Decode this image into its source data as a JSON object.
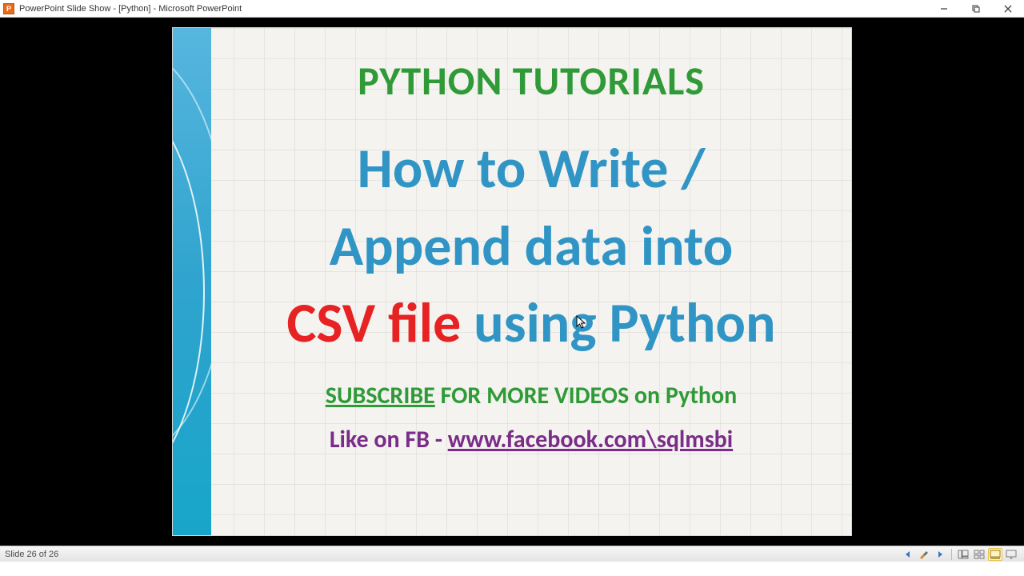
{
  "titlebar": {
    "app_icon_letter": "P",
    "title": "PowerPoint Slide Show - [Python] - Microsoft PowerPoint"
  },
  "slide": {
    "heading": "PYTHON TUTORIALS",
    "line1": "How to Write /",
    "line2": "Append data into",
    "line3_part1": "CSV file",
    "line3_part2": " using Python",
    "subscribe_word": "SUBSCRIBE",
    "subscribe_rest": " FOR MORE VIDEOS on Python",
    "fb_prefix": "Like on FB - ",
    "fb_url": "www.facebook.com\\sqlmsbi"
  },
  "status": {
    "slide_indicator": "Slide 26 of 26"
  }
}
